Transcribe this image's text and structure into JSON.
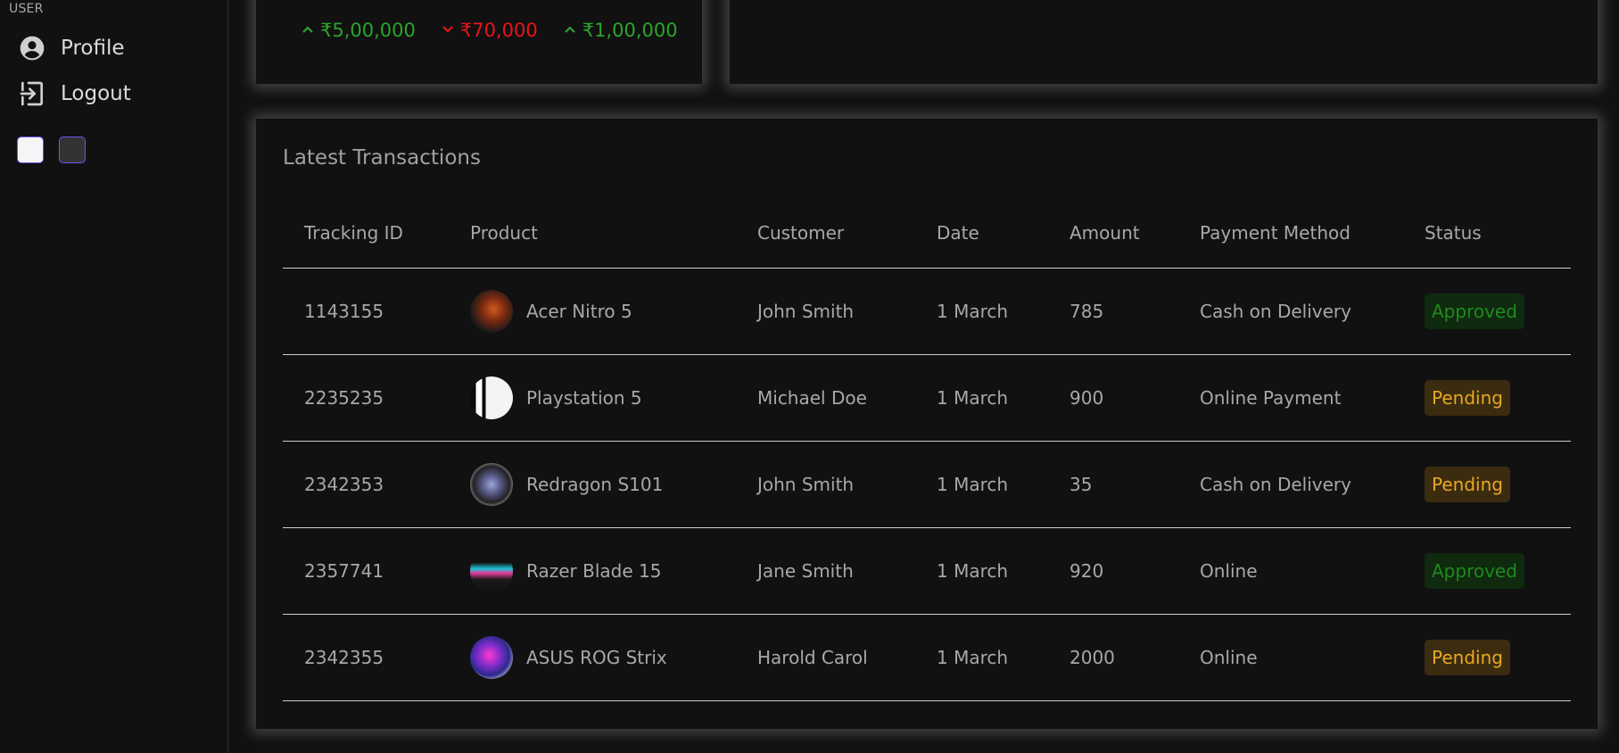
{
  "sidebar": {
    "section_title": "USER",
    "items": [
      {
        "label": "Profile",
        "icon": "account-circle-icon"
      },
      {
        "label": "Logout",
        "icon": "logout-icon"
      }
    ],
    "theme_options": [
      "light",
      "dark"
    ]
  },
  "stats": [
    {
      "value": "₹5,00,000",
      "trend": "up"
    },
    {
      "value": "₹70,000",
      "trend": "down"
    },
    {
      "value": "₹1,00,000",
      "trend": "up"
    }
  ],
  "colors": {
    "up": "#2ba52b",
    "down": "#e8141a",
    "approved_text": "#1f8a1f",
    "pending_text": "#e8a822"
  },
  "transactions": {
    "title": "Latest Transactions",
    "headers": [
      "Tracking ID",
      "Product",
      "Customer",
      "Date",
      "Amount",
      "Payment Method",
      "Status"
    ],
    "rows": [
      {
        "id": "1143155",
        "product": "Acer Nitro 5",
        "customer": "John Smith",
        "date": "1 March",
        "amount": "785",
        "method": "Cash on Delivery",
        "status": "Approved"
      },
      {
        "id": "2235235",
        "product": "Playstation 5",
        "customer": "Michael Doe",
        "date": "1 March",
        "amount": "900",
        "method": "Online Payment",
        "status": "Pending"
      },
      {
        "id": "2342353",
        "product": "Redragon S101",
        "customer": "John Smith",
        "date": "1 March",
        "amount": "35",
        "method": "Cash on Delivery",
        "status": "Pending"
      },
      {
        "id": "2357741",
        "product": "Razer Blade 15",
        "customer": "Jane Smith",
        "date": "1 March",
        "amount": "920",
        "method": "Online",
        "status": "Approved"
      },
      {
        "id": "2342355",
        "product": "ASUS ROG Strix",
        "customer": "Harold Carol",
        "date": "1 March",
        "amount": "2000",
        "method": "Online",
        "status": "Pending"
      }
    ]
  }
}
